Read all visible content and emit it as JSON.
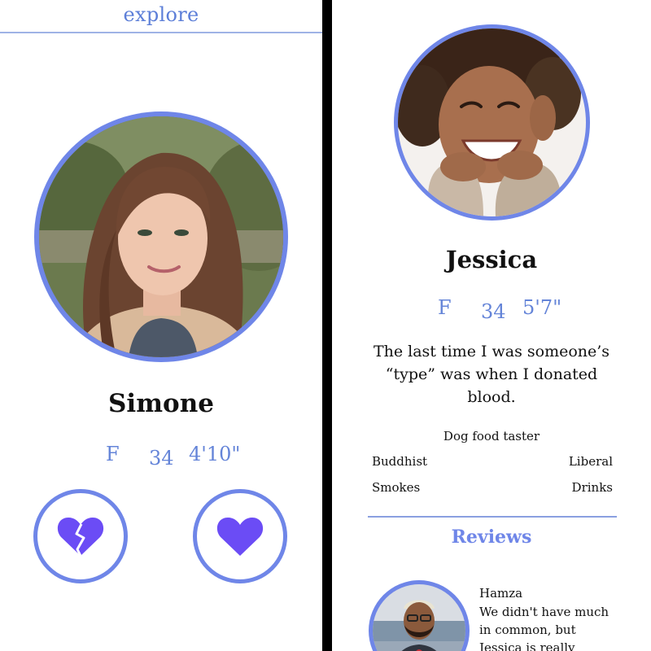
{
  "left_panel": {
    "header_title": "explore",
    "profile": {
      "name": "Simone",
      "gender": "F",
      "age": "34",
      "height": "4'10\""
    },
    "actions": {
      "dislike_icon": "broken-heart-icon",
      "like_icon": "heart-icon"
    }
  },
  "right_panel": {
    "profile": {
      "name": "Jessica",
      "gender": "F",
      "age": "34",
      "height": "5'7\"",
      "bio": "The last time I was someone’s “type” was when I donated blood.",
      "job": "Dog food taster",
      "religion": "Buddhist",
      "politics": "Liberal",
      "smoking": "Smokes",
      "drinking": "Drinks"
    },
    "reviews": {
      "title": "Reviews",
      "items": [
        {
          "reviewer": "Hamza",
          "text": "We didn't have much in common, but Jessica is really"
        }
      ]
    }
  },
  "colors": {
    "accent": "#6f86e8",
    "accent_text": "#6484d8",
    "heart_purple": "#6b4cf5",
    "divider": "#000000"
  }
}
